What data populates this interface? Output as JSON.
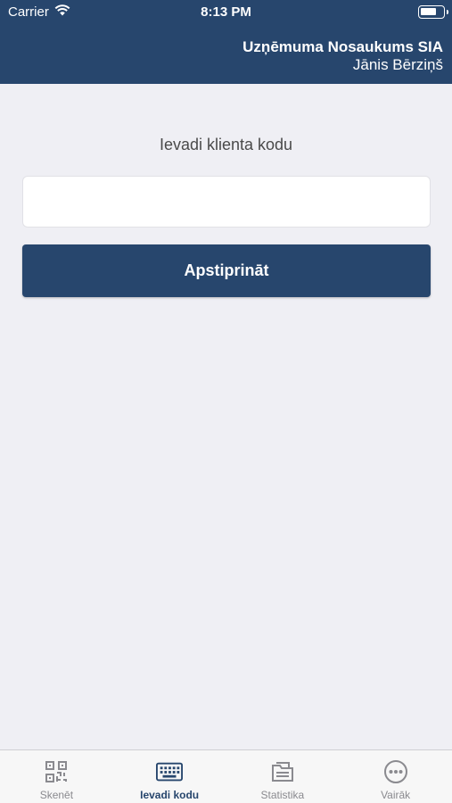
{
  "status_bar": {
    "carrier": "Carrier",
    "time": "8:13 PM",
    "icons": [
      "wifi-icon",
      "battery-icon"
    ]
  },
  "header": {
    "company": "Uzņēmuma Nosaukums SIA",
    "user": "Jānis Bērziņš",
    "background": "#27466d"
  },
  "main": {
    "prompt": "Ievadi klienta kodu",
    "code_input": {
      "value": "",
      "placeholder": ""
    },
    "confirm_label": "Apstiprināt"
  },
  "tabbar": {
    "items": [
      {
        "label": "Skenēt",
        "icon": "qr-code-icon",
        "active": false
      },
      {
        "label": "Ievadi kodu",
        "icon": "keyboard-icon",
        "active": true
      },
      {
        "label": "Statistika",
        "icon": "folder-icon",
        "active": false
      },
      {
        "label": "Vairāk",
        "icon": "more-icon",
        "active": false
      }
    ],
    "active_color": "#27466d",
    "inactive_color": "#8a8a8f"
  }
}
